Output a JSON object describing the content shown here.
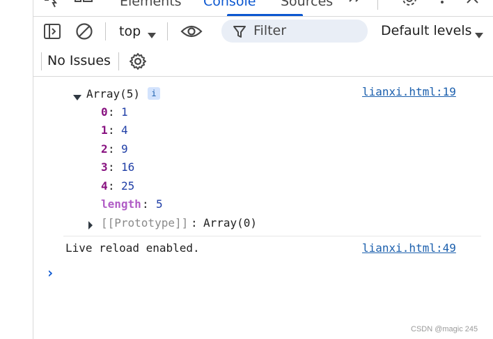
{
  "tabs": [
    {
      "label": "Elements",
      "active": false
    },
    {
      "label": "Console",
      "active": true
    },
    {
      "label": "Sources",
      "active": false
    }
  ],
  "toolbar": {
    "context": "top",
    "filter_placeholder": "Filter",
    "levels": "Default levels",
    "issues": "No Issues"
  },
  "console": {
    "array_header": "Array(5)",
    "info_badge": "i",
    "source_1": "lianxi.html:19",
    "entries": [
      {
        "key": "0",
        "value": "1"
      },
      {
        "key": "1",
        "value": "4"
      },
      {
        "key": "2",
        "value": "9"
      },
      {
        "key": "3",
        "value": "16"
      },
      {
        "key": "4",
        "value": "25"
      }
    ],
    "length_key": "length",
    "length_value": "5",
    "prototype_key": "[[Prototype]]",
    "prototype_value": "Array(0)",
    "message_2": "Live reload enabled.",
    "source_2": "lianxi.html:49",
    "prompt": "›"
  },
  "watermark": "CSDN @magic 245",
  "colors": {
    "accent": "#0b57d0",
    "filter_bg": "#e9eef6",
    "link": "#1b5fad",
    "property_key": "#881280",
    "number_value": "#1f3ea6"
  },
  "icons": [
    "inspect-icon",
    "device-toggle-icon",
    "more-tabs-icon",
    "settings-icon",
    "more-vert-icon",
    "close-icon",
    "sidebar-toggle-icon",
    "clear-console-icon",
    "chevron-down-icon",
    "eye-icon",
    "filter-icon",
    "gear-icon",
    "expand-triangle-icon",
    "collapse-triangle-icon",
    "prompt-icon"
  ]
}
